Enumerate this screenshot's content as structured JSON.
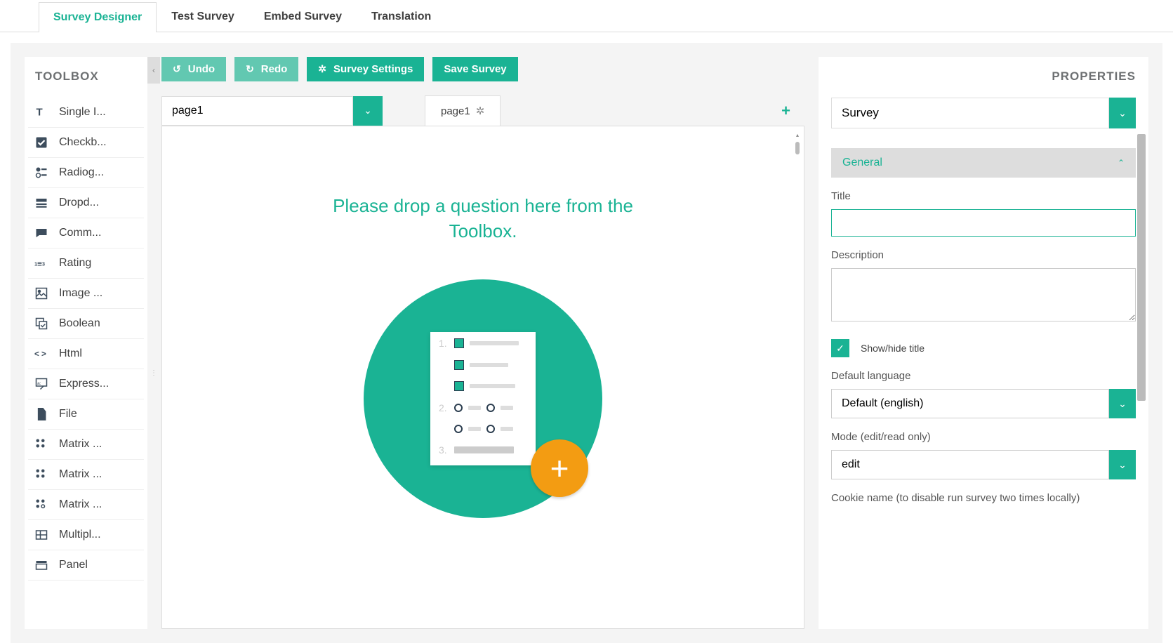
{
  "tabs": {
    "survey_designer": "Survey Designer",
    "test_survey": "Test Survey",
    "embed_survey": "Embed Survey",
    "translation": "Translation"
  },
  "toolbox": {
    "title": "TOOLBOX",
    "items": [
      {
        "label": "Single I..."
      },
      {
        "label": "Checkb..."
      },
      {
        "label": "Radiog..."
      },
      {
        "label": "Dropd..."
      },
      {
        "label": "Comm..."
      },
      {
        "label": "Rating"
      },
      {
        "label": "Image ..."
      },
      {
        "label": "Boolean"
      },
      {
        "label": "Html"
      },
      {
        "label": "Express..."
      },
      {
        "label": "File"
      },
      {
        "label": "Matrix ..."
      },
      {
        "label": "Matrix ..."
      },
      {
        "label": "Matrix ..."
      },
      {
        "label": "Multipl..."
      },
      {
        "label": "Panel"
      }
    ]
  },
  "actions": {
    "undo": "Undo",
    "redo": "Redo",
    "survey_settings": "Survey Settings",
    "save_survey": "Save Survey"
  },
  "pages": {
    "selected": "page1",
    "tab_label": "page1"
  },
  "canvas": {
    "drop_hint": "Please drop a question here from the Toolbox."
  },
  "properties": {
    "title": "PROPERTIES",
    "object_selected": "Survey",
    "sections": {
      "general": "General"
    },
    "fields": {
      "title_label": "Title",
      "title_value": "",
      "description_label": "Description",
      "description_value": "",
      "show_hide_title_label": "Show/hide title",
      "show_hide_title_checked": true,
      "default_language_label": "Default language",
      "default_language_value": "Default (english)",
      "mode_label": "Mode (edit/read only)",
      "mode_value": "edit",
      "cookie_label": "Cookie name (to disable run survey two times locally)"
    }
  }
}
